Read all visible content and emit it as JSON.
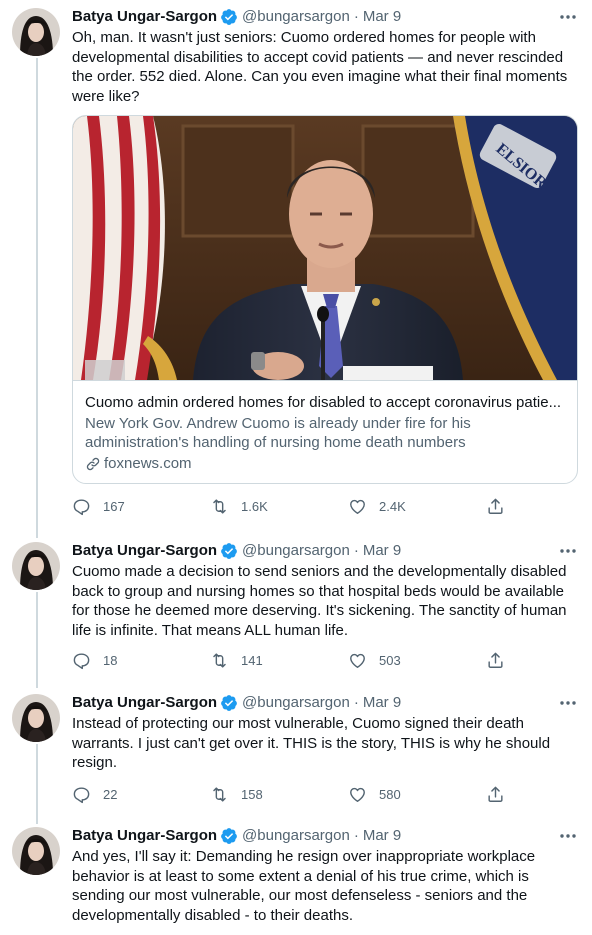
{
  "tweets": [
    {
      "author_name": "Batya Ungar-Sargon",
      "handle": "@bungarsargon",
      "separator": "·",
      "date": "Mar 9",
      "text": "Oh, man. It wasn't just seniors: Cuomo ordered homes for people with developmental disabilities to accept covid patients — and never rescinded the order. 552 died. Alone. Can you even imagine what their final moments were like?",
      "card": {
        "title": "Cuomo admin ordered homes for disabled to accept coronavirus patie...",
        "description": "New York Gov. Andrew Cuomo is already under fire for his administration's handling of nursing home death numbers",
        "domain": "foxnews.com",
        "flag_text": "ELSIOR"
      },
      "replies": "167",
      "retweets": "1.6K",
      "likes": "2.4K"
    },
    {
      "author_name": "Batya Ungar-Sargon",
      "handle": "@bungarsargon",
      "separator": "·",
      "date": "Mar 9",
      "text": "Cuomo made a decision to send seniors and the developmentally disabled back to group and nursing homes so that hospital beds would be available for those he deemed more deserving. It's sickening. The sanctity of human life is infinite. That means ALL human life.",
      "replies": "18",
      "retweets": "141",
      "likes": "503"
    },
    {
      "author_name": "Batya Ungar-Sargon",
      "handle": "@bungarsargon",
      "separator": "·",
      "date": "Mar 9",
      "text": "Instead of protecting our most vulnerable, Cuomo signed their death warrants. I just can't get over it. THIS is the story, THIS is why he should resign.",
      "replies": "22",
      "retweets": "158",
      "likes": "580"
    },
    {
      "author_name": "Batya Ungar-Sargon",
      "handle": "@bungarsargon",
      "separator": "·",
      "date": "Mar 9",
      "text": "And yes, I'll say it: Demanding he resign over inappropriate workplace behavior is at least to some extent a denial of his true crime, which is sending our most vulnerable, our most defenseless - seniors and the developmentally disabled - to their deaths."
    }
  ],
  "icons": {
    "verified": "verified-badge-icon",
    "more": "more-dots-icon",
    "reply": "reply-icon",
    "retweet": "retweet-icon",
    "like": "heart-icon",
    "share": "share-icon",
    "link": "link-icon"
  },
  "colors": {
    "text": "#0f1419",
    "secondary": "#536471",
    "verified": "#1d9bf0",
    "border": "#cfd9de"
  }
}
